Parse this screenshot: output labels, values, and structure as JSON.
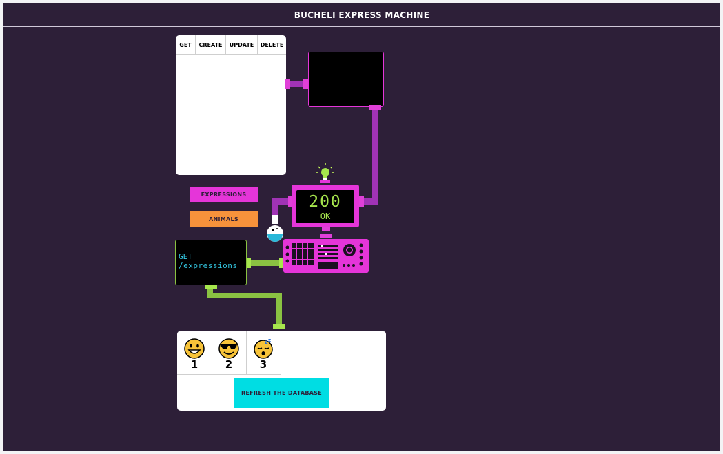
{
  "app": {
    "title": "Bucheli Express Machine"
  },
  "crud_tabs": [
    {
      "label": "GET"
    },
    {
      "label": "CREATE"
    },
    {
      "label": "UPDATE"
    },
    {
      "label": "DELETE"
    }
  ],
  "resources": [
    {
      "label": "Expressions",
      "color": "#e535d9"
    },
    {
      "label": "Animals",
      "color": "#f7923b"
    }
  ],
  "status": {
    "code": "200",
    "text": "OK"
  },
  "request": {
    "method": "GET",
    "path": "/expressions"
  },
  "database": {
    "items": [
      {
        "id": "1",
        "emoji": "grinning-face"
      },
      {
        "id": "2",
        "emoji": "smiling-face-with-sunglasses"
      },
      {
        "id": "3",
        "emoji": "sleeping-face"
      }
    ],
    "refresh_label": "Refresh the Database"
  },
  "colors": {
    "background": "#2d1f38",
    "machine": "#e535d9",
    "pipe_purple": "#a033b5",
    "pipe_green": "#8ac242",
    "request_text": "#33c6e0",
    "status_text": "#a6e64d",
    "refresh": "#00dde3"
  }
}
